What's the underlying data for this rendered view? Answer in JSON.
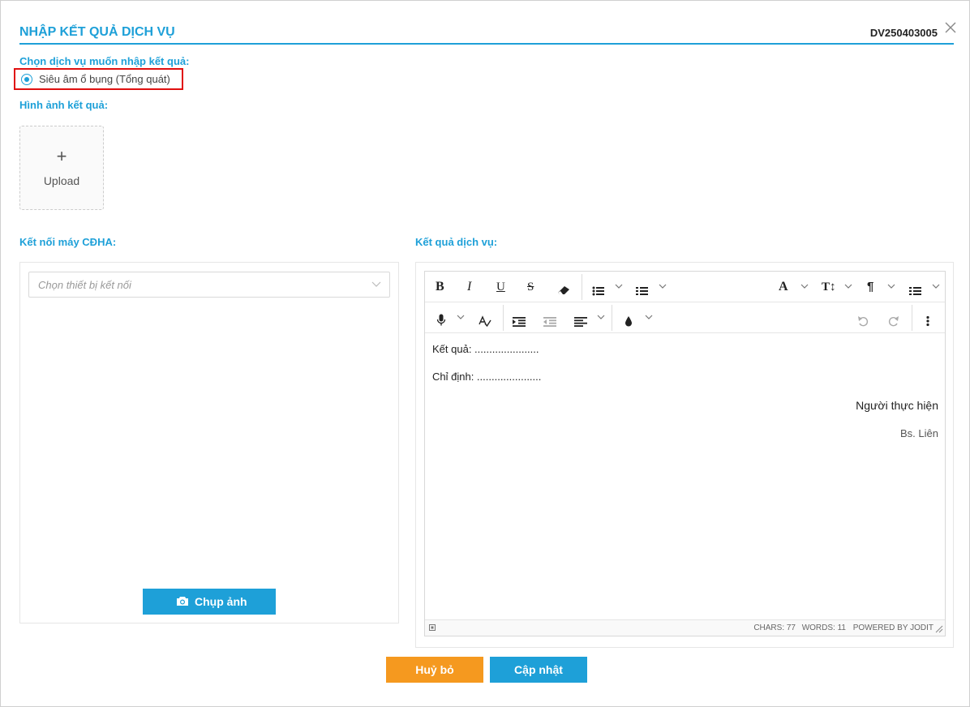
{
  "modal": {
    "title": "NHẬP KẾT QUẢ DỊCH VỤ",
    "code": "DV250403005",
    "close_icon": "close-icon"
  },
  "service": {
    "label": "Chọn dịch vụ muốn nhập kết quả:",
    "options": [
      {
        "label": "Siêu âm ổ bụng (Tổng quát)",
        "selected": true
      }
    ]
  },
  "images": {
    "label": "Hình ảnh kết quả:",
    "upload_plus": "+",
    "upload_label": "Upload"
  },
  "device": {
    "label": "Kết nối máy CĐHA:",
    "select_placeholder": "Chọn thiết bị kết nối",
    "capture_label": "Chụp ảnh",
    "capture_icon": "camera-icon"
  },
  "result": {
    "label": "Kết quả dịch vụ:",
    "toolbar_icons": [
      "bold-icon",
      "italic-icon",
      "underline-icon",
      "strikethrough-icon",
      "eraser-icon",
      "unordered-list-icon",
      "ordered-list-icon",
      "font-icon",
      "font-size-icon",
      "paragraph-icon",
      "table-icon",
      "microphone-icon",
      "spellcheck-icon",
      "indent-icon",
      "outdent-icon",
      "align-icon",
      "color-icon",
      "undo-icon",
      "redo-icon",
      "more-icon"
    ],
    "content": {
      "line1_label": "Kết quả: ",
      "line1_dots": "......................",
      "line2_label": "Chỉ định: ",
      "line2_dots": "......................",
      "performer": "Người thực hiện",
      "doctor": "Bs. Liên"
    },
    "status": {
      "chars": "CHARS: 77",
      "words": "WORDS: 11",
      "powered": "POWERED BY JODIT"
    }
  },
  "footer": {
    "cancel_label": "Huỷ bỏ",
    "update_label": "Cập nhật"
  },
  "colors": {
    "accent": "#1ea0d8",
    "cancel": "#f5991f",
    "highlight": "#e01010"
  }
}
